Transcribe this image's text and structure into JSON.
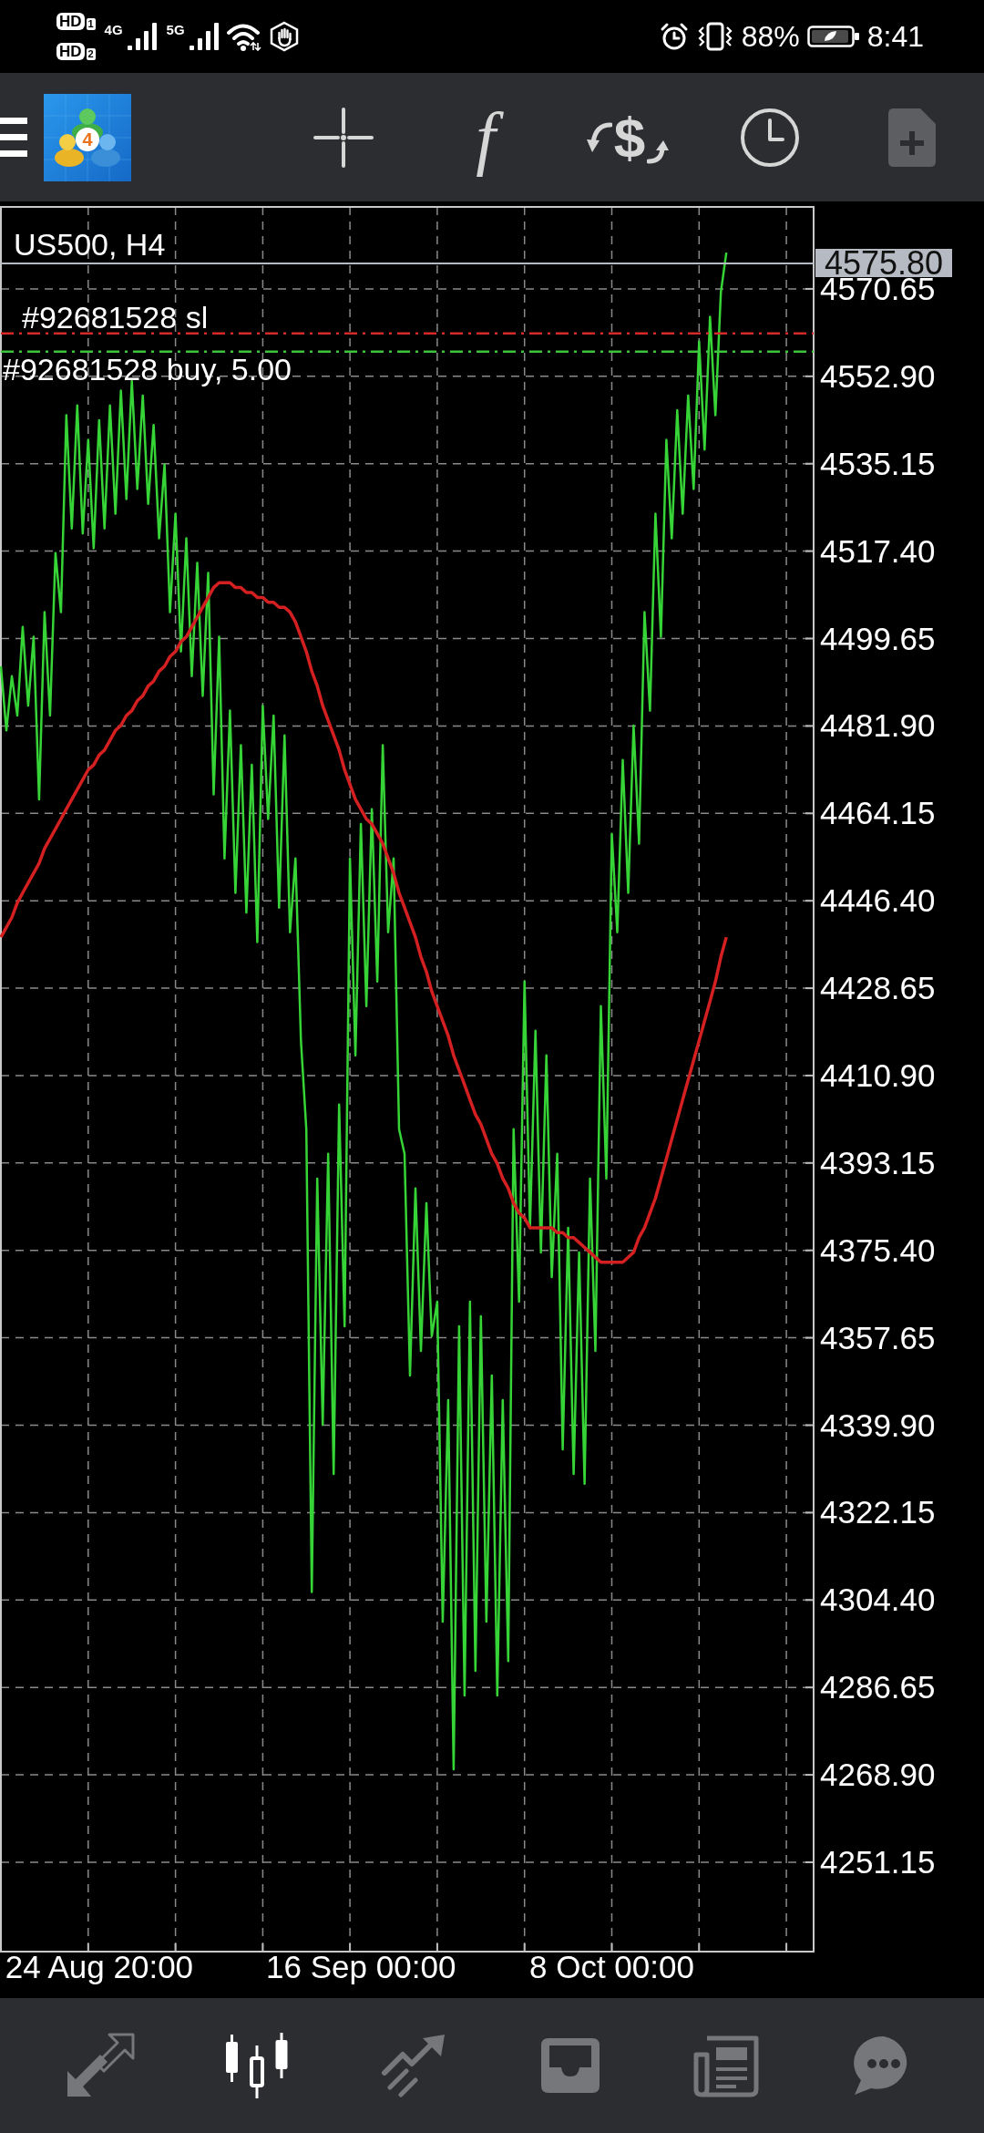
{
  "status_bar": {
    "sims": [
      {
        "badge": "HD",
        "slot": "1"
      },
      {
        "badge": "HD",
        "slot": "2"
      }
    ],
    "networks": [
      "4G",
      "5G"
    ],
    "battery": "88%",
    "time": "8:41"
  },
  "toolbar": {
    "logo_badge": "4",
    "buttons": [
      {
        "kind": "crosshair",
        "disabled": false
      },
      {
        "kind": "indicators",
        "glyph": "f",
        "disabled": false
      },
      {
        "kind": "symbols",
        "glyph": "$",
        "disabled": false
      },
      {
        "kind": "timeframe",
        "disabled": false
      },
      {
        "kind": "new_order",
        "disabled": true
      }
    ]
  },
  "chart": {
    "chart_data": {
      "type": "line",
      "title": "US500, H4",
      "grid": true,
      "categories": [
        null,
        null,
        null,
        null,
        null,
        null,
        null,
        null,
        null,
        null,
        null,
        null,
        null,
        null,
        null,
        null,
        null,
        null,
        "24 Aug 20:00",
        null,
        null,
        null,
        null,
        null,
        null,
        null,
        null,
        null,
        null,
        null,
        null,
        null,
        null,
        null,
        null,
        null,
        null,
        null,
        null,
        null,
        null,
        null,
        null,
        null,
        null,
        null,
        null,
        null,
        null,
        null,
        null,
        null,
        null,
        null,
        null,
        null,
        null,
        null,
        null,
        null,
        null,
        null,
        null,
        null,
        null,
        null,
        "16 Sep 00:00",
        null,
        null,
        null,
        null,
        null,
        null,
        null,
        null,
        null,
        null,
        null,
        null,
        null,
        null,
        null,
        null,
        null,
        null,
        null,
        null,
        null,
        null,
        null,
        null,
        null,
        null,
        null,
        null,
        null,
        null,
        null,
        null,
        null,
        null,
        null,
        null,
        null,
        null,
        null,
        null,
        null,
        null,
        null,
        null,
        null,
        "8 Oct 00:00",
        null,
        null,
        null,
        null,
        null,
        null,
        null,
        null,
        null,
        null,
        null,
        null,
        null,
        null,
        null,
        null,
        null,
        null,
        null,
        null,
        null,
        null,
        null,
        null,
        null,
        null,
        null,
        null,
        null,
        null,
        null,
        null,
        null,
        null,
        null,
        null
      ],
      "ylim": [
        4233.0,
        4587.3
      ],
      "yticks": [
        {
          "value": 4570.65,
          "label": "4570.65"
        },
        {
          "value": 4552.9,
          "label": "4552.90"
        },
        {
          "value": 4535.15,
          "label": "4535.15"
        },
        {
          "value": 4517.4,
          "label": "4517.40"
        },
        {
          "value": 4499.65,
          "label": "4499.65"
        },
        {
          "value": 4481.9,
          "label": "4481.90"
        },
        {
          "value": 4464.15,
          "label": "4464.15"
        },
        {
          "value": 4446.4,
          "label": "4446.40"
        },
        {
          "value": 4428.65,
          "label": "4428.65"
        },
        {
          "value": 4410.9,
          "label": "4410.90"
        },
        {
          "value": 4393.15,
          "label": "4393.15"
        },
        {
          "value": 4375.4,
          "label": "4375.40"
        },
        {
          "value": 4357.65,
          "label": "4357.65"
        },
        {
          "value": 4339.9,
          "label": "4339.90"
        },
        {
          "value": 4322.15,
          "label": "4322.15"
        },
        {
          "value": 4304.4,
          "label": "4304.40"
        },
        {
          "value": 4286.65,
          "label": "4286.65"
        },
        {
          "value": 4268.9,
          "label": "4268.90"
        },
        {
          "value": 4251.15,
          "label": "4251.15"
        }
      ],
      "series": [
        {
          "color": "#36d436",
          "values": [
            4494,
            4481,
            4492,
            4484,
            4502,
            4486,
            4500,
            4467,
            4505,
            4484,
            4517,
            4505,
            4545,
            4522,
            4547,
            4521,
            4540,
            4518,
            4544,
            4522,
            4547,
            4525,
            4550,
            4528,
            4552,
            4530,
            4549,
            4527,
            4543,
            4520,
            4535,
            4505,
            4525,
            4497,
            4520,
            4492,
            4515,
            4488,
            4513,
            4468,
            4500,
            4455,
            4485,
            4448,
            4478,
            4444,
            4474,
            4438,
            4486,
            4463,
            4484,
            4445,
            4480,
            4440,
            4455,
            4418,
            4400,
            4306,
            4390,
            4340,
            4395,
            4330,
            4405,
            4360,
            4455,
            4415,
            4462,
            4425,
            4465,
            4430,
            4478,
            4440,
            4455,
            4400,
            4395,
            4350,
            4388,
            4355,
            4385,
            4358,
            4365,
            4300,
            4345,
            4270,
            4360,
            4285,
            4365,
            4290,
            4362,
            4300,
            4350,
            4285,
            4345,
            4292,
            4400,
            4365,
            4430,
            4380,
            4420,
            4375,
            4415,
            4370,
            4395,
            4335,
            4380,
            4330,
            4375,
            4328,
            4390,
            4355,
            4425,
            4390,
            4460,
            4440,
            4475,
            4448,
            4482,
            4458,
            4505,
            4485,
            4525,
            4500,
            4540,
            4520,
            4546,
            4525,
            4549,
            4530,
            4560,
            4538,
            4565,
            4545,
            4570,
            4578,
            null,
            null,
            null,
            null,
            null,
            null,
            null,
            null,
            null,
            null,
            null,
            null,
            null,
            null,
            null
          ]
        },
        {
          "color": "#d42020",
          "values": [
            4439,
            4441,
            4443,
            4446,
            4448,
            4450,
            4452,
            4454,
            4457,
            4459,
            4461,
            4463,
            4465,
            4467,
            4469,
            4471,
            4473,
            4474,
            4476,
            4477,
            4479,
            4481,
            4482,
            4484,
            4485,
            4487,
            4488,
            4490,
            4491,
            4493,
            4494,
            4496,
            4497,
            4499,
            4500,
            4502,
            4504,
            4506,
            4508,
            4510,
            4511,
            4511,
            4511,
            4510,
            4510,
            4509,
            4509,
            4508,
            4508,
            4507,
            4507,
            4506,
            4506,
            4505,
            4503,
            4500,
            4497,
            4493,
            4490,
            4486,
            4483,
            4480,
            4477,
            4473,
            4470,
            4467,
            4465,
            4463,
            4462,
            4460,
            4458,
            4455,
            4452,
            4448,
            4445,
            4442,
            4439,
            4435,
            4432,
            4428,
            4425,
            4422,
            4419,
            4415,
            4412,
            4409,
            4406,
            4403,
            4401,
            4398,
            4395,
            4393,
            4390,
            4388,
            4385,
            4383,
            4382,
            4380,
            4380,
            4380,
            4380,
            4380,
            4379,
            4379,
            4378,
            4378,
            4377,
            4376,
            4375,
            4374,
            4373,
            4373,
            4373,
            4373,
            4373,
            4374,
            4375,
            4378,
            4380,
            4383,
            4386,
            4390,
            4394,
            4398,
            4402,
            4406,
            4410,
            4414,
            4418,
            4422,
            4426,
            4430,
            4435,
            4439,
            null,
            null,
            null,
            null,
            null,
            null,
            null,
            null,
            null,
            null,
            null,
            null,
            null,
            null,
            null
          ]
        }
      ],
      "ref_lines": [
        {
          "axis": "y",
          "value": 4575.8,
          "label": "4575.80",
          "color": "#b6bac2"
        },
        {
          "axis": "y",
          "value": 4561.6,
          "label": "#92681528 sl",
          "color": "#d42a2a"
        },
        {
          "axis": "y",
          "value": 4557.9,
          "label": "#92681528 buy, 5.00",
          "color": "#3cc43c"
        }
      ]
    }
  },
  "bottom_nav": [
    {
      "kind": "trade",
      "selected": false
    },
    {
      "kind": "chart",
      "selected": true
    },
    {
      "kind": "history",
      "selected": false
    },
    {
      "kind": "mailbox",
      "selected": false
    },
    {
      "kind": "news",
      "selected": false
    },
    {
      "kind": "chat",
      "selected": false
    }
  ]
}
